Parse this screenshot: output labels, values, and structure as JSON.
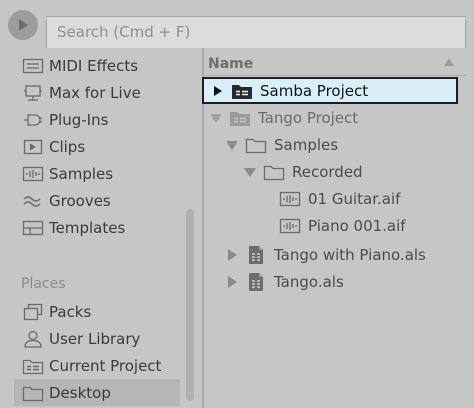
{
  "search": {
    "placeholder": "Search (Cmd + F)"
  },
  "sidebar": {
    "categories": [
      {
        "label": "MIDI Effects",
        "icon": "midi-effects-icon"
      },
      {
        "label": "Max for Live",
        "icon": "max-for-live-icon"
      },
      {
        "label": "Plug-Ins",
        "icon": "plugin-icon"
      },
      {
        "label": "Clips",
        "icon": "clips-icon"
      },
      {
        "label": "Samples",
        "icon": "samples-icon"
      },
      {
        "label": "Grooves",
        "icon": "grooves-icon"
      },
      {
        "label": "Templates",
        "icon": "templates-icon"
      }
    ],
    "places_header": "Places",
    "places": [
      {
        "label": "Packs",
        "icon": "packs-icon"
      },
      {
        "label": "User Library",
        "icon": "user-icon"
      },
      {
        "label": "Current Project",
        "icon": "project-folder-icon"
      },
      {
        "label": "Desktop",
        "icon": "folder-icon",
        "selected": true
      }
    ]
  },
  "pane": {
    "column_header": "Name",
    "rows": [
      {
        "label": "Samba Project",
        "type": "project-folder",
        "expanded": false,
        "selected": true
      },
      {
        "label": "Tango Project",
        "type": "project-folder",
        "expanded": true
      },
      {
        "label": "Samples",
        "type": "folder",
        "expanded": true
      },
      {
        "label": "Recorded",
        "type": "folder",
        "expanded": true
      },
      {
        "label": "01 Guitar.aif",
        "type": "audio-file"
      },
      {
        "label": "Piano 001.aif",
        "type": "audio-file"
      },
      {
        "label": "Tango with Piano.als",
        "type": "live-set",
        "expanded": false
      },
      {
        "label": "Tango.als",
        "type": "live-set",
        "expanded": false
      }
    ]
  },
  "colors": {
    "background": "#c6c6c6",
    "selection_fill": "#d7f0fa",
    "selection_border": "#1e1e1e",
    "text": "#3a3a3a"
  }
}
